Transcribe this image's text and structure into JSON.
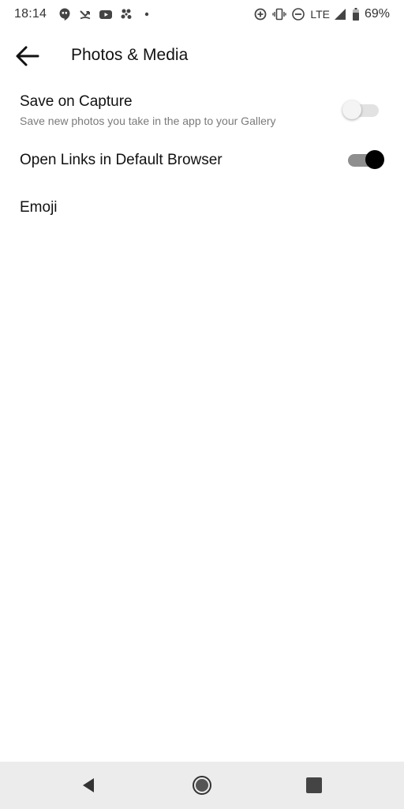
{
  "status_bar": {
    "time": "18:14",
    "left_icons": [
      "hangouts-icon",
      "missed-call-icon",
      "youtube-icon",
      "pinwheel-icon",
      "dot-icon"
    ],
    "right_icons": [
      "data-saver-icon",
      "vibrate-icon",
      "do-not-disturb-icon",
      "signal-icon",
      "battery-icon"
    ],
    "network": "LTE",
    "battery": "69%"
  },
  "header": {
    "back_icon": "arrow-left-icon",
    "title": "Photos & Media"
  },
  "settings": [
    {
      "title": "Save on Capture",
      "subtitle": "Save new photos you take in the app to your Gallery",
      "toggle": "off"
    },
    {
      "title": "Open Links in Default Browser",
      "toggle": "on"
    },
    {
      "title": "Emoji"
    }
  ],
  "nav_bar": {
    "buttons": [
      "back-triangle-icon",
      "home-circle-icon",
      "recents-square-icon"
    ]
  },
  "colors": {
    "toggle_on_thumb": "#000000",
    "toggle_on_track": "#8e8e8e",
    "toggle_off_thumb": "#f4f4f4",
    "toggle_off_track": "#e2e2e2",
    "nav_bar_bg": "#ececec"
  }
}
